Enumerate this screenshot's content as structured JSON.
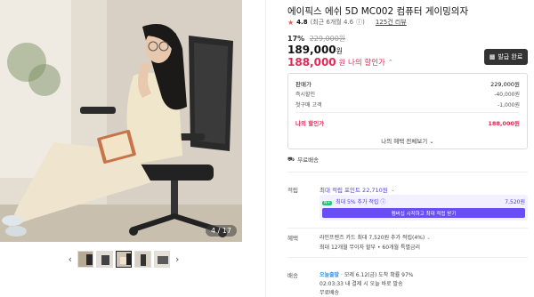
{
  "gallery": {
    "counter": "4 / 17",
    "prev_icon": "chevron-left-icon",
    "next_icon": "chevron-right-icon",
    "thumbnail_count": 5,
    "active_thumbnail": 3
  },
  "product": {
    "title": "에이픽스 에쉬 5D MC002 컴퓨터 게이밍의자",
    "rating": {
      "score": "4.8",
      "recent": "(최근 6개월 4.6",
      "reviews": "125건 리뷰"
    },
    "discount_rate": "17%",
    "original_price": "229,000원",
    "sale_price": "189,000",
    "my_price": "188,000",
    "currency": "원",
    "my_sale_label": "나의 할인가",
    "coupon_button": "발급 완료"
  },
  "price_breakdown": {
    "rows": [
      {
        "label": "판매가",
        "value": "229,000원"
      },
      {
        "label": "즉시할인",
        "value": "-40,000원"
      },
      {
        "label": "첫구매 고객",
        "value": "-1,000원"
      }
    ],
    "final": {
      "label": "나의 할인가",
      "value": "188,000원"
    },
    "more": "나의 혜택 전체보기"
  },
  "shipping_badge": "무료배송",
  "points": {
    "label": "적립",
    "max": "최대 적립 포인트 22,710원",
    "membership_badge": "N+",
    "membership_text": "최대 5% 추가 적립",
    "membership_value": "7,520원",
    "membership_button": "멤버십 시작하고 최대 적립 받기"
  },
  "card": {
    "label": "혜택",
    "line1": "라인프렌즈 카드 최대 7,520원 추가 적립(4%)",
    "line2": "최대 12개월 무이자 할부 • 60개월 특별금리"
  },
  "delivery": {
    "label": "배송",
    "fast": "오늘출발",
    "fast_rest": "· 모레 6.12(금) 도착 확률 97%",
    "line2": "02:03:33 내 결제 시 오늘 바로 발송",
    "line3": "무료배송"
  },
  "colors": {
    "accent_red": "#e02a58",
    "accent_purple": "#6a4ef5",
    "naver_green": "#2ec27e"
  }
}
